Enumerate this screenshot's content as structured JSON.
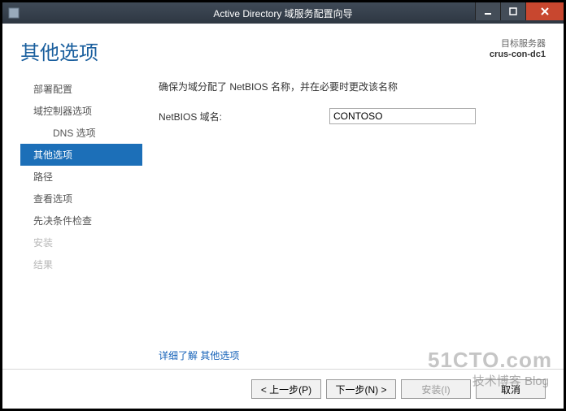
{
  "window": {
    "title": "Active Directory 域服务配置向导"
  },
  "header": {
    "page_title": "其他选项",
    "server_label": "目标服务器",
    "server_name": "crus-con-dc1"
  },
  "sidebar": {
    "items": [
      {
        "label": "部署配置",
        "kind": "norm"
      },
      {
        "label": "域控制器选项",
        "kind": "norm"
      },
      {
        "label": "DNS 选项",
        "kind": "sub"
      },
      {
        "label": "其他选项",
        "kind": "sel"
      },
      {
        "label": "路径",
        "kind": "norm"
      },
      {
        "label": "查看选项",
        "kind": "norm"
      },
      {
        "label": "先决条件检查",
        "kind": "norm"
      },
      {
        "label": "安装",
        "kind": "dis"
      },
      {
        "label": "结果",
        "kind": "dis"
      }
    ]
  },
  "main": {
    "hint": "确保为域分配了 NetBIOS 名称，并在必要时更改该名称",
    "netbios_label": "NetBIOS 域名:",
    "netbios_value": "CONTOSO",
    "more_link": "详细了解 其他选项"
  },
  "footer": {
    "prev": "< 上一步(P)",
    "next": "下一步(N) >",
    "install": "安装(I)",
    "cancel": "取消"
  },
  "watermark": {
    "line1": "51CTO.com",
    "line2": "技术博客  Blog"
  }
}
